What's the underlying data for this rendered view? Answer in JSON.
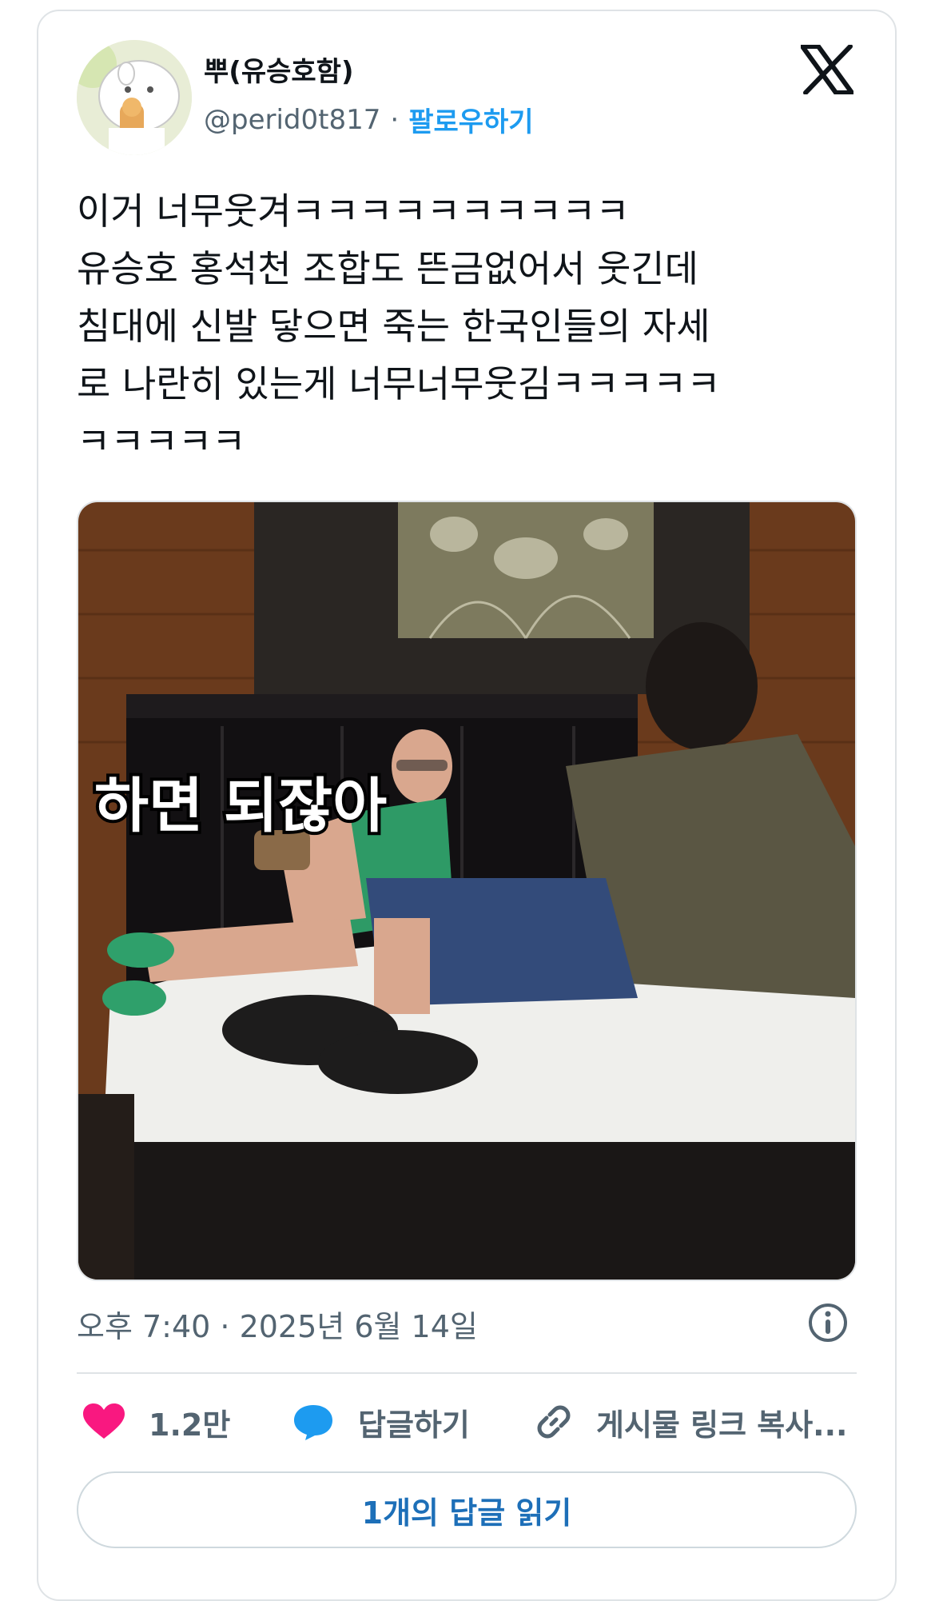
{
  "tweet": {
    "author_name": "뿌(유승호함)",
    "handle": "@perid0t817",
    "separator": "·",
    "follow_label": "팔로우하기",
    "text": "이거 너무웃겨ㅋㅋㅋㅋㅋㅋㅋㅋㅋㅋ\n유승호 홍석천 조합도 뜬금없어서 웃긴데\n침대에 신발 닿으면 죽는 한국인들의 자세\n로 나란히 있는게 너무너무웃김ㅋㅋㅋㅋㅋ\nㅋㅋㅋㅋㅋ",
    "media_caption": "하면 되잖아",
    "timestamp": "오후 7:40 · 2025년 6월 14일",
    "like_count": "1.2만",
    "reply_label": "답글하기",
    "copy_link_label": "게시물 링크 복사...",
    "read_replies_label": "1개의 답글 읽기"
  },
  "icons": {
    "platform": "x-logo-icon",
    "info": "info-icon",
    "like": "heart-icon",
    "reply": "speech-bubble-icon",
    "copy": "link-icon"
  },
  "colors": {
    "like": "#f91880",
    "reply": "#1d9bf0",
    "follow": "#1d9bf0",
    "read_button_text": "#1d6fb8",
    "muted_text": "#536471"
  }
}
